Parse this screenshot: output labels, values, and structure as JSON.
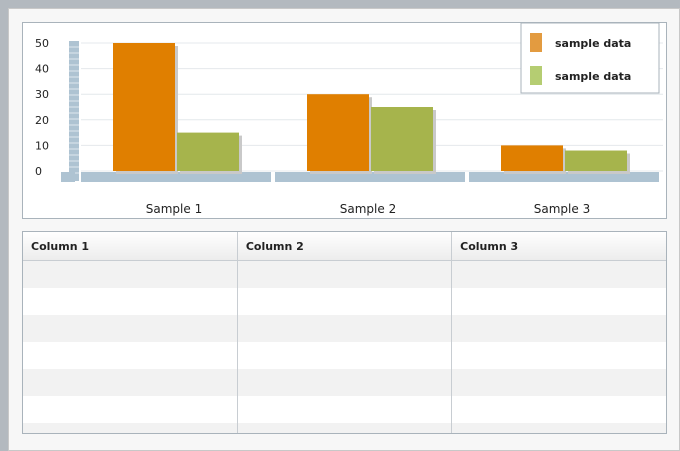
{
  "chart_data": {
    "type": "bar",
    "categories": [
      "Sample 1",
      "Sample 2",
      "Sample 3"
    ],
    "series": [
      {
        "name": "sample data",
        "values": [
          50,
          30,
          10
        ],
        "color": "#e07f00"
      },
      {
        "name": "sample data",
        "values": [
          15,
          25,
          8
        ],
        "color": "#a6b44c"
      }
    ],
    "y_ticks": [
      0,
      10,
      20,
      30,
      40,
      50
    ],
    "ylim": [
      0,
      50
    ],
    "legend_position": "top-right",
    "legend_colors": [
      "#e39b40",
      "#b5cd72"
    ]
  },
  "grid": {
    "columns": [
      "Column 1",
      "Column 2",
      "Column 3"
    ],
    "row_count": 7
  },
  "colors": {
    "background": "#b3b9bf",
    "axis_track": "#aec3d2",
    "border": "#a9b3bb"
  }
}
